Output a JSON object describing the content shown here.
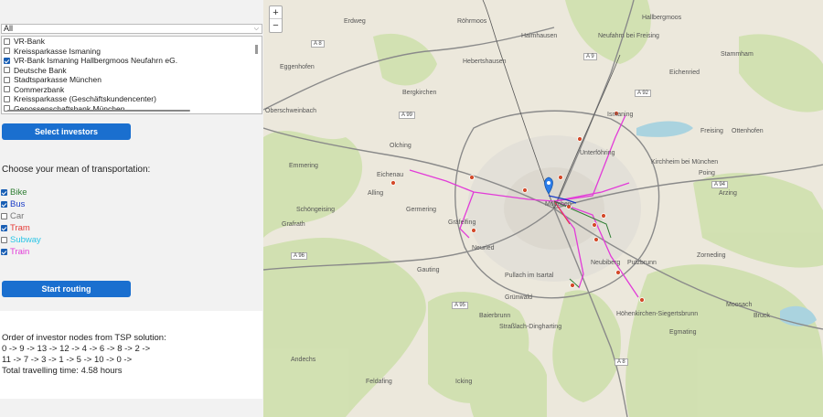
{
  "filter": {
    "value": "All"
  },
  "banks": [
    {
      "label": "VR-Bank",
      "checked": false
    },
    {
      "label": "Kreissparkasse Ismaning",
      "checked": false
    },
    {
      "label": "VR-Bank Ismaning Hallbergmoos Neufahrn eG.",
      "checked": true
    },
    {
      "label": "Deutsche Bank",
      "checked": false
    },
    {
      "label": "Stadtsparkasse München",
      "checked": false
    },
    {
      "label": "Commerzbank",
      "checked": false
    },
    {
      "label": "Kreissparkasse (Geschäftskundencenter)",
      "checked": false
    },
    {
      "label": "Genossenschaftsbank München",
      "checked": false
    }
  ],
  "buttons": {
    "select_investors": "Select investors",
    "start_routing": "Start routing"
  },
  "transport": {
    "heading": "Choose your mean of transportation:",
    "modes": [
      {
        "label": "Bike",
        "checked": true,
        "color": "#2e7d32"
      },
      {
        "label": "Bus",
        "checked": true,
        "color": "#1a3cc7"
      },
      {
        "label": "Car",
        "checked": false,
        "color": "#777777"
      },
      {
        "label": "Tram",
        "checked": true,
        "color": "#e53935"
      },
      {
        "label": "Subway",
        "checked": false,
        "color": "#29c5e6"
      },
      {
        "label": "Train",
        "checked": true,
        "color": "#e23bd8"
      }
    ]
  },
  "result": {
    "title": "Order of investor nodes from TSP solution:",
    "order_line1": " 0 -> 9 -> 13 -> 12 -> 4 -> 6 -> 8 -> 2 ->",
    "order_line2": " 11 -> 7 -> 3 -> 1 -> 5 -> 10 -> 0 ->",
    "total": "Total travelling time: 4.58 hours"
  },
  "map": {
    "zoom_in": "+",
    "zoom_out": "−",
    "places": [
      "Erdweg",
      "Röhrmoos",
      "Hallbergmoos",
      "Haimhausen",
      "Neufahrn bei Freising",
      "Stammham",
      "Eggenhofen",
      "Hebertshausen",
      "Eichenried",
      "Bergkirchen",
      "Oberschweinbach",
      "Ismaning",
      "Freising",
      "Ottenhofen",
      "Olching",
      "Unterföhring",
      "Kirchheim bei München",
      "Emmering",
      "Eichenau",
      "Poing",
      "Alling",
      "Arzing",
      "Germering",
      "Gräfelfing",
      "München",
      "Schöngeising",
      "Neuried",
      "Gauting",
      "Pullach im Isartal",
      "Neubiberg",
      "Putzbrunn",
      "Zorneding",
      "Grafrath",
      "Grünwald",
      "Höhenkirchen-Siegertsbrunn",
      "Baierbrunn",
      "Moosach",
      "Bruck",
      "Straßlach-Dingharting",
      "Egmating",
      "Andechs",
      "Feldafing",
      "Icking"
    ],
    "roads": [
      "A 8",
      "A 9",
      "A 92",
      "A 99",
      "A 94",
      "A 96",
      "A 95",
      "A 8"
    ],
    "colors": {
      "train": "#e23bd8",
      "bus": "#1a3cc7",
      "tram": "#e53935",
      "bike": "#2e7d32",
      "marker": "#2b7de9",
      "node": "#d44a2a"
    }
  }
}
